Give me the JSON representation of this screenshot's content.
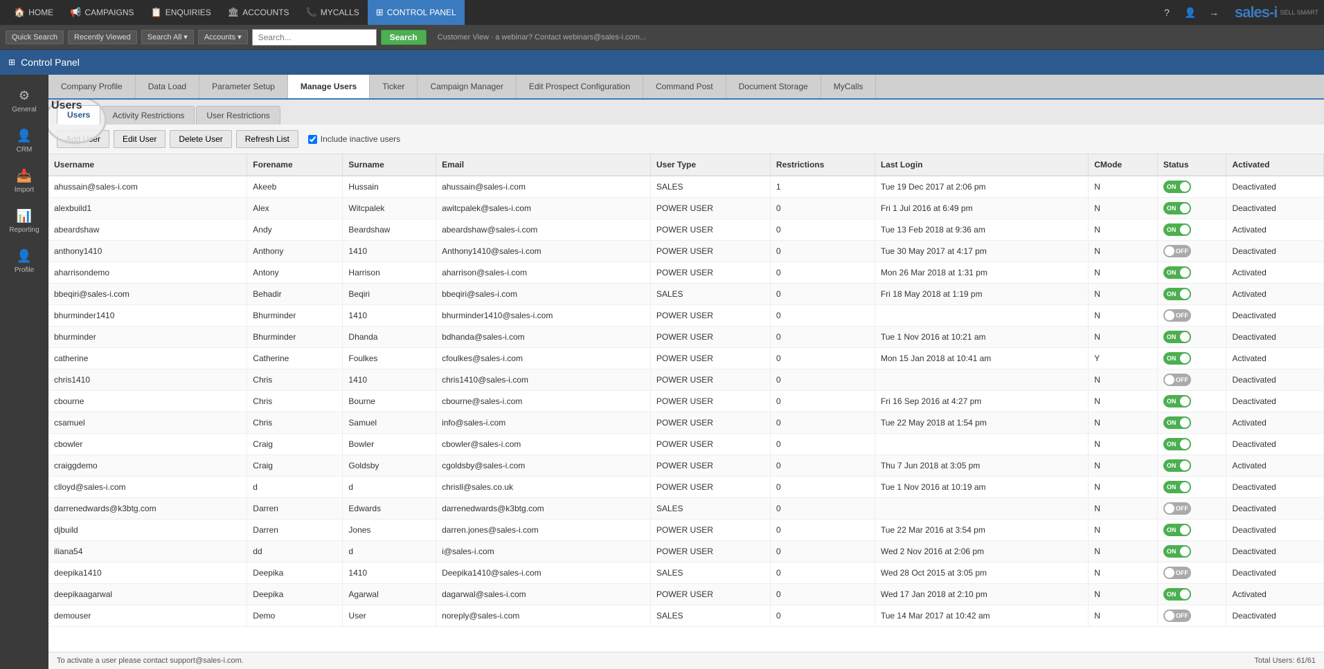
{
  "topnav": {
    "items": [
      {
        "id": "home",
        "label": "HOME",
        "icon": "🏠",
        "active": false
      },
      {
        "id": "campaigns",
        "label": "CAMPAIGNS",
        "icon": "📢",
        "active": false
      },
      {
        "id": "enquiries",
        "label": "ENQUIRIES",
        "icon": "📋",
        "active": false
      },
      {
        "id": "accounts",
        "label": "ACCOUNTS",
        "icon": "🏛",
        "active": false
      },
      {
        "id": "mycalls",
        "label": "MYCALLS",
        "icon": "📞",
        "active": false
      },
      {
        "id": "controlpanel",
        "label": "CONTROL PANEL",
        "icon": "⊞",
        "active": true
      }
    ]
  },
  "searchbar": {
    "quicksearch_label": "Quick Search",
    "recentlyviewed_label": "Recently Viewed",
    "searchall_label": "Search All",
    "accounts_label": "Accounts",
    "search_placeholder": "Search...",
    "search_btn": "Search",
    "contact_text": "Customer View   ∙ a webinar? Contact webinars@sales-i.com..."
  },
  "cpheader": {
    "title": "Control Panel"
  },
  "sidebar": {
    "items": [
      {
        "id": "general",
        "label": "General",
        "icon": "⚙"
      },
      {
        "id": "crm",
        "label": "CRM",
        "icon": "👤"
      },
      {
        "id": "import",
        "label": "Import",
        "icon": "📥"
      },
      {
        "id": "reporting",
        "label": "Reporting",
        "icon": "📊"
      },
      {
        "id": "profile",
        "label": "Profile",
        "icon": "👤"
      }
    ]
  },
  "tabs": [
    {
      "id": "company-profile",
      "label": "Company Profile"
    },
    {
      "id": "data-load",
      "label": "Data Load"
    },
    {
      "id": "parameter-setup",
      "label": "Parameter Setup"
    },
    {
      "id": "manage-users",
      "label": "Manage Users",
      "active": true
    },
    {
      "id": "ticker",
      "label": "Ticker"
    },
    {
      "id": "campaign-manager",
      "label": "Campaign Manager"
    },
    {
      "id": "edit-prospect",
      "label": "Edit Prospect Configuration"
    },
    {
      "id": "command-post",
      "label": "Command Post"
    },
    {
      "id": "document-storage",
      "label": "Document Storage"
    },
    {
      "id": "mycalls",
      "label": "MyCalls"
    }
  ],
  "subtabs": [
    {
      "id": "users",
      "label": "Users",
      "active": true
    },
    {
      "id": "activity-restrictions",
      "label": "Activity Restrictions"
    },
    {
      "id": "user-restrictions",
      "label": "User Restrictions"
    }
  ],
  "toolbar": {
    "add_user": "Add User",
    "edit_user": "Edit User",
    "delete_user": "Delete User",
    "refresh_list": "Refresh List",
    "include_inactive": "Include inactive users"
  },
  "table": {
    "columns": [
      "Username",
      "Forename",
      "Surname",
      "Email",
      "User Type",
      "Restrictions",
      "Last Login",
      "CMode",
      "Status",
      "Activated"
    ],
    "rows": [
      {
        "username": "ahussain@sales-i.com",
        "forename": "Akeeb",
        "surname": "Hussain",
        "email": "ahussain@sales-i.com",
        "usertype": "SALES",
        "restrictions": "1",
        "lastlogin": "Tue 19 Dec 2017 at 2:06 pm",
        "cmode": "N",
        "status_on": true,
        "activated": "Deactivated"
      },
      {
        "username": "alexbuild1",
        "forename": "Alex",
        "surname": "Witcpalek",
        "email": "awitcpalek@sales-i.com",
        "usertype": "POWER USER",
        "restrictions": "0",
        "lastlogin": "Fri 1 Jul 2016 at 6:49 pm",
        "cmode": "N",
        "status_on": true,
        "activated": "Deactivated"
      },
      {
        "username": "abeardshaw",
        "forename": "Andy",
        "surname": "Beardshaw",
        "email": "abeardshaw@sales-i.com",
        "usertype": "POWER USER",
        "restrictions": "0",
        "lastlogin": "Tue 13 Feb 2018 at 9:36 am",
        "cmode": "N",
        "status_on": true,
        "activated": "Activated"
      },
      {
        "username": "anthony1410",
        "forename": "Anthony",
        "surname": "1410",
        "email": "Anthony1410@sales-i.com",
        "usertype": "POWER USER",
        "restrictions": "0",
        "lastlogin": "Tue 30 May 2017 at 4:17 pm",
        "cmode": "N",
        "status_on": false,
        "activated": "Deactivated"
      },
      {
        "username": "aharrisondemo",
        "forename": "Antony",
        "surname": "Harrison",
        "email": "aharrison@sales-i.com",
        "usertype": "POWER USER",
        "restrictions": "0",
        "lastlogin": "Mon 26 Mar 2018 at 1:31 pm",
        "cmode": "N",
        "status_on": true,
        "activated": "Activated"
      },
      {
        "username": "bbeqiri@sales-i.com",
        "forename": "Behadir",
        "surname": "Beqiri",
        "email": "bbeqiri@sales-i.com",
        "usertype": "SALES",
        "restrictions": "0",
        "lastlogin": "Fri 18 May 2018 at 1:19 pm",
        "cmode": "N",
        "status_on": true,
        "activated": "Activated"
      },
      {
        "username": "bhurminder1410",
        "forename": "Bhurminder",
        "surname": "1410",
        "email": "bhurminder1410@sales-i.com",
        "usertype": "POWER USER",
        "restrictions": "0",
        "lastlogin": "",
        "cmode": "N",
        "status_on": false,
        "activated": "Deactivated"
      },
      {
        "username": "bhurminder",
        "forename": "Bhurminder",
        "surname": "Dhanda",
        "email": "bdhanda@sales-i.com",
        "usertype": "POWER USER",
        "restrictions": "0",
        "lastlogin": "Tue 1 Nov 2016 at 10:21 am",
        "cmode": "N",
        "status_on": true,
        "activated": "Deactivated"
      },
      {
        "username": "catherine",
        "forename": "Catherine",
        "surname": "Foulkes",
        "email": "cfoulkes@sales-i.com",
        "usertype": "POWER USER",
        "restrictions": "0",
        "lastlogin": "Mon 15 Jan 2018 at 10:41 am",
        "cmode": "Y",
        "status_on": true,
        "activated": "Activated"
      },
      {
        "username": "chris1410",
        "forename": "Chris",
        "surname": "1410",
        "email": "chris1410@sales-i.com",
        "usertype": "POWER USER",
        "restrictions": "0",
        "lastlogin": "",
        "cmode": "N",
        "status_on": false,
        "activated": "Deactivated"
      },
      {
        "username": "cbourne",
        "forename": "Chris",
        "surname": "Bourne",
        "email": "cbourne@sales-i.com",
        "usertype": "POWER USER",
        "restrictions": "0",
        "lastlogin": "Fri 16 Sep 2016 at 4:27 pm",
        "cmode": "N",
        "status_on": true,
        "activated": "Deactivated"
      },
      {
        "username": "csamuel",
        "forename": "Chris",
        "surname": "Samuel",
        "email": "info@sales-i.com",
        "usertype": "POWER USER",
        "restrictions": "0",
        "lastlogin": "Tue 22 May 2018 at 1:54 pm",
        "cmode": "N",
        "status_on": true,
        "activated": "Activated"
      },
      {
        "username": "cbowler",
        "forename": "Craig",
        "surname": "Bowler",
        "email": "cbowler@sales-i.com",
        "usertype": "POWER USER",
        "restrictions": "0",
        "lastlogin": "",
        "cmode": "N",
        "status_on": true,
        "activated": "Deactivated"
      },
      {
        "username": "craiggdemo",
        "forename": "Craig",
        "surname": "Goldsby",
        "email": "cgoldsby@sales-i.com",
        "usertype": "POWER USER",
        "restrictions": "0",
        "lastlogin": "Thu 7 Jun 2018 at 3:05 pm",
        "cmode": "N",
        "status_on": true,
        "activated": "Activated"
      },
      {
        "username": "clloyd@sales-i.com",
        "forename": "d",
        "surname": "d",
        "email": "chrisll@sales.co.uk",
        "usertype": "POWER USER",
        "restrictions": "0",
        "lastlogin": "Tue 1 Nov 2016 at 10:19 am",
        "cmode": "N",
        "status_on": true,
        "activated": "Deactivated"
      },
      {
        "username": "darrenedwards@k3btg.com",
        "forename": "Darren",
        "surname": "Edwards",
        "email": "darrenedwards@k3btg.com",
        "usertype": "SALES",
        "restrictions": "0",
        "lastlogin": "",
        "cmode": "N",
        "status_on": false,
        "activated": "Deactivated"
      },
      {
        "username": "djbuild",
        "forename": "Darren",
        "surname": "Jones",
        "email": "darren.jones@sales-i.com",
        "usertype": "POWER USER",
        "restrictions": "0",
        "lastlogin": "Tue 22 Mar 2016 at 3:54 pm",
        "cmode": "N",
        "status_on": true,
        "activated": "Deactivated"
      },
      {
        "username": "iliana54",
        "forename": "dd",
        "surname": "d",
        "email": "i@sales-i.com",
        "usertype": "POWER USER",
        "restrictions": "0",
        "lastlogin": "Wed 2 Nov 2016 at 2:06 pm",
        "cmode": "N",
        "status_on": true,
        "activated": "Deactivated"
      },
      {
        "username": "deepika1410",
        "forename": "Deepika",
        "surname": "1410",
        "email": "Deepika1410@sales-i.com",
        "usertype": "SALES",
        "restrictions": "0",
        "lastlogin": "Wed 28 Oct 2015 at 3:05 pm",
        "cmode": "N",
        "status_on": false,
        "activated": "Deactivated"
      },
      {
        "username": "deepikaagarwal",
        "forename": "Deepika",
        "surname": "Agarwal",
        "email": "dagarwal@sales-i.com",
        "usertype": "POWER USER",
        "restrictions": "0",
        "lastlogin": "Wed 17 Jan 2018 at 2:10 pm",
        "cmode": "N",
        "status_on": true,
        "activated": "Activated"
      },
      {
        "username": "demouser",
        "forename": "Demo",
        "surname": "User",
        "email": "noreply@sales-i.com",
        "usertype": "SALES",
        "restrictions": "0",
        "lastlogin": "Tue 14 Mar 2017 at 10:42 am",
        "cmode": "N",
        "status_on": false,
        "activated": "Deactivated"
      }
    ]
  },
  "footer": {
    "activate_note": "To activate a user please contact support@sales-i.com.",
    "total_users": "Total Users: 61/61"
  }
}
